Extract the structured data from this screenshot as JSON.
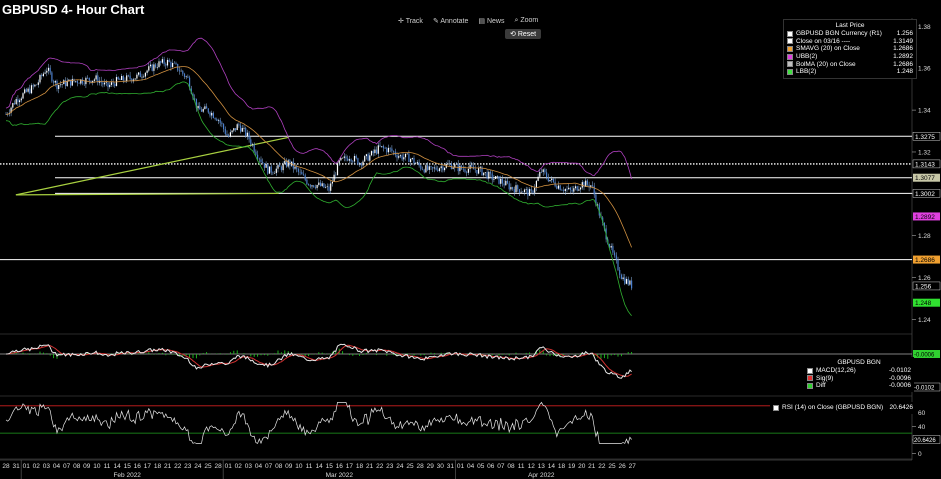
{
  "title": "GBPUSD 4- Hour Chart",
  "toolbar": {
    "track": "Track",
    "annotate": "Annotate",
    "news": "News",
    "zoom": "Zoom",
    "reset": "Reset"
  },
  "price_legend": {
    "header": "Last Price",
    "rows": [
      {
        "name": "GBPUSD BGN Currency  (R1)",
        "value": "1.256",
        "color": "#ffffff"
      },
      {
        "name": "Close on 03/16 ----",
        "value": "1.3149",
        "color": "#ffffff"
      },
      {
        "name": "SMAVG (20)  on Close",
        "value": "1.2686",
        "color": "#f0a030"
      },
      {
        "name": "UBB(2)",
        "value": "1.2892",
        "color": "#e040e0"
      },
      {
        "name": "BolMA (20)  on Close",
        "value": "1.2686",
        "color": "#c0c0c0"
      },
      {
        "name": "LBB(2)",
        "value": "1.248",
        "color": "#40e040"
      }
    ]
  },
  "macd_legend": {
    "header": "GBPUSD BGN",
    "rows": [
      {
        "name": "MACD(12,26)",
        "value": "-0.0102",
        "color": "#ffffff"
      },
      {
        "name": "Sig(9)",
        "value": "-0.0096",
        "color": "#e03030"
      },
      {
        "name": "Diff",
        "value": "-0.0006",
        "color": "#30d030"
      }
    ]
  },
  "rsi_legend": {
    "label": "RSI (14)  on Close (GBPUSD BGN)",
    "value": "20.6426"
  },
  "chart_data": [
    {
      "type": "candlestick",
      "panel": "price",
      "title": "GBPUSD 4- Hour Chart",
      "y_axis_ticks": [
        1.38,
        1.36,
        1.34,
        1.32,
        1.3,
        1.28,
        1.26,
        1.24
      ],
      "ylim": [
        1.234,
        1.384
      ],
      "horizontal_levels": [
        1.3275,
        1.3143,
        1.3077,
        1.3002,
        1.2686
      ],
      "value_labels": [
        {
          "text": "1.3275",
          "value": 1.3275,
          "bg": "#000000",
          "fg": "#ffffff"
        },
        {
          "text": "1.3143",
          "value": 1.3143,
          "bg": "#000000",
          "fg": "#ffffff"
        },
        {
          "text": "1.3077",
          "value": 1.3077,
          "bg": "#c8c8a8",
          "fg": "#000000"
        },
        {
          "text": "1.3002",
          "value": 1.3002,
          "bg": "#000000",
          "fg": "#ffffff"
        },
        {
          "text": "1.2892",
          "value": 1.2892,
          "bg": "#e040e0",
          "fg": "#000000"
        },
        {
          "text": "1.2686",
          "value": 1.2686,
          "bg": "#f0a030",
          "fg": "#000000"
        },
        {
          "text": "1.256",
          "value": 1.256,
          "bg": "#000000",
          "fg": "#ffffff"
        },
        {
          "text": "1.248",
          "value": 1.248,
          "bg": "#30e030",
          "fg": "#000000"
        }
      ],
      "trendlines": [
        {
          "from": [
            "Mar 09",
            1.327
          ],
          "to": [
            "Mar 27",
            1.2995
          ],
          "color": "#a8d040"
        },
        {
          "from": [
            "Mar 08",
            1.3002
          ],
          "to": [
            "Mar 27",
            1.2995
          ],
          "color": "#a8d040"
        }
      ],
      "close_path": [
        [
          "Jan 28",
          1.338
        ],
        [
          "Jan 31",
          1.345
        ],
        [
          "Feb 02",
          1.352
        ],
        [
          "Feb 03",
          1.36
        ],
        [
          "Feb 04",
          1.352
        ],
        [
          "Feb 07",
          1.353
        ],
        [
          "Feb 08",
          1.354
        ],
        [
          "Feb 10",
          1.355
        ],
        [
          "Feb 11",
          1.351
        ],
        [
          "Feb 14",
          1.354
        ],
        [
          "Feb 16",
          1.356
        ],
        [
          "Feb 18",
          1.362
        ],
        [
          "Feb 21",
          1.363
        ],
        [
          "Feb 22",
          1.36
        ],
        [
          "Feb 23",
          1.355
        ],
        [
          "Feb 24",
          1.34
        ],
        [
          "Feb 25",
          1.34
        ],
        [
          "Feb 28",
          1.336
        ],
        [
          "Mar 01",
          1.327
        ],
        [
          "Mar 02",
          1.333
        ],
        [
          "Mar 03",
          1.327
        ],
        [
          "Mar 04",
          1.318
        ],
        [
          "Mar 07",
          1.311
        ],
        [
          "Mar 08",
          1.312
        ],
        [
          "Mar 09",
          1.315
        ],
        [
          "Mar 10",
          1.31
        ],
        [
          "Mar 11",
          1.305
        ],
        [
          "Mar 14",
          1.304
        ],
        [
          "Mar 15",
          1.302
        ],
        [
          "Mar 16",
          1.315
        ],
        [
          "Mar 17",
          1.318
        ],
        [
          "Mar 18",
          1.315
        ],
        [
          "Mar 21",
          1.318
        ],
        [
          "Mar 22",
          1.322
        ],
        [
          "Mar 23",
          1.321
        ],
        [
          "Mar 24",
          1.318
        ],
        [
          "Mar 25",
          1.317
        ],
        [
          "Mar 28",
          1.313
        ],
        [
          "Mar 29",
          1.311
        ],
        [
          "Mar 30",
          1.313
        ],
        [
          "Mar 31",
          1.314
        ],
        [
          "Apr 01",
          1.312
        ],
        [
          "Apr 04",
          1.312
        ],
        [
          "Apr 05",
          1.311
        ],
        [
          "Apr 06",
          1.308
        ],
        [
          "Apr 07",
          1.306
        ],
        [
          "Apr 08",
          1.303
        ],
        [
          "Apr 11",
          1.302
        ],
        [
          "Apr 12",
          1.3
        ],
        [
          "Apr 13",
          1.311
        ],
        [
          "Apr 14",
          1.306
        ],
        [
          "Apr 18",
          1.303
        ],
        [
          "Apr 19",
          1.301
        ],
        [
          "Apr 20",
          1.305
        ],
        [
          "Apr 21",
          1.304
        ],
        [
          "Apr 22",
          1.286
        ],
        [
          "Apr 25",
          1.272
        ],
        [
          "Apr 26",
          1.26
        ],
        [
          "Apr 27",
          1.256
        ]
      ]
    },
    {
      "type": "line",
      "panel": "macd",
      "legend_header": "GBPUSD BGN",
      "series": [
        {
          "name": "MACD(12,26)",
          "last": -0.0102
        },
        {
          "name": "Sig(9)",
          "last": -0.0096
        },
        {
          "name": "Diff",
          "last": -0.0006
        }
      ],
      "value_labels": [
        {
          "text": "-0.0006",
          "value": -0.0006,
          "bg": "#30d030",
          "fg": "#000000"
        },
        {
          "text": "-0.0102",
          "value": -0.0102,
          "bg": "#000000",
          "fg": "#ffffff"
        }
      ]
    },
    {
      "type": "line",
      "panel": "rsi",
      "series": [
        {
          "name": "RSI (14)  on Close (GBPUSD BGN)",
          "last": 20.6426
        }
      ],
      "y_axis_ticks": [
        60,
        40,
        20,
        0
      ],
      "ylim": [
        -5,
        80
      ],
      "reference_lines": [
        70,
        30
      ],
      "value_labels": [
        {
          "text": "20.6426",
          "value": 20.6426
        }
      ]
    }
  ],
  "x_axis": {
    "day_ticks": [
      "28",
      "31",
      "01",
      "02",
      "03",
      "04",
      "07",
      "08",
      "09",
      "10",
      "11",
      "14",
      "15",
      "16",
      "17",
      "18",
      "21",
      "22",
      "23",
      "24",
      "25",
      "28",
      "01",
      "02",
      "03",
      "04",
      "07",
      "08",
      "09",
      "10",
      "11",
      "14",
      "15",
      "16",
      "17",
      "18",
      "21",
      "22",
      "23",
      "24",
      "25",
      "28",
      "29",
      "30",
      "31",
      "01",
      "04",
      "05",
      "06",
      "07",
      "08",
      "11",
      "12",
      "13",
      "14",
      "18",
      "19",
      "20",
      "21",
      "22",
      "25",
      "26",
      "27"
    ],
    "month_labels": [
      "Feb 2022",
      "Mar 2022",
      "Apr 2022"
    ]
  }
}
